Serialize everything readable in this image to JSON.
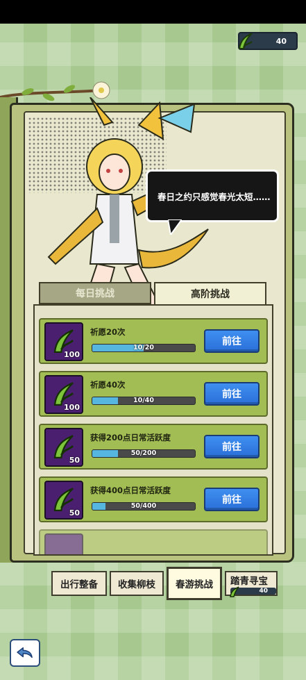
{
  "currency": {
    "amount": "40",
    "icon": "willow-branch-icon"
  },
  "speech": {
    "text": "春日之约只感觉春光太短……"
  },
  "tabs": {
    "daily": "每日挑战",
    "advanced": "高阶挑战",
    "selected": "advanced"
  },
  "tasks": [
    {
      "title": "祈愿20次",
      "reward": "100",
      "progress_text": "10/20",
      "progress": 0.5,
      "button": "前往"
    },
    {
      "title": "祈愿40次",
      "reward": "100",
      "progress_text": "10/40",
      "progress": 0.25,
      "button": "前往"
    },
    {
      "title": "获得200点日常活跃度",
      "reward": "50",
      "progress_text": "50/200",
      "progress": 0.25,
      "button": "前往"
    },
    {
      "title": "获得400点日常活跃度",
      "reward": "50",
      "progress_text": "50/400",
      "progress": 0.125,
      "button": "前往"
    }
  ],
  "bottom_nav": {
    "item1": "出行整备",
    "item2": "收集柳枝",
    "item3": "春游挑战",
    "item4": "踏青寻宝",
    "item4_amount": "40",
    "selected": "item3"
  },
  "colors": {
    "accent_blue": "#2a6fd8",
    "row_green": "#a3bd55",
    "bar_fill": "#56b6df"
  }
}
